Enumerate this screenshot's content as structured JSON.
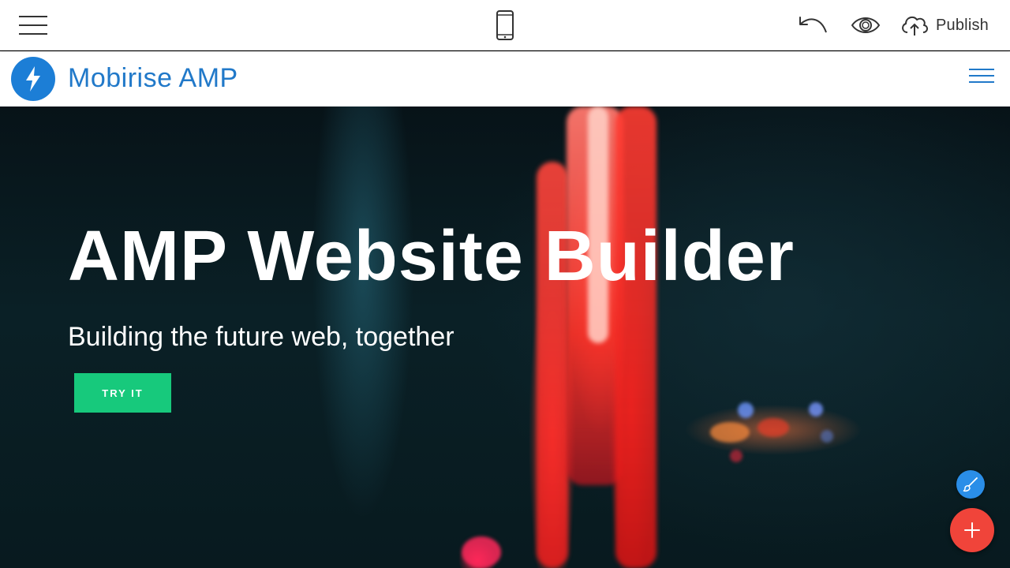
{
  "toolbar": {
    "menu_icon": "hamburger-menu-icon",
    "device_icon": "mobile-phone-icon",
    "undo_icon": "undo-icon",
    "preview_icon": "eye-icon",
    "publish_icon": "cloud-upload-icon",
    "publish_label": "Publish"
  },
  "site_nav": {
    "logo_icon": "lightning-bolt-icon",
    "brand_name": "Mobirise AMP",
    "menu_icon": "hamburger-menu-icon"
  },
  "hero": {
    "title": "AMP Website Builder",
    "subtitle": "Building the future web, together",
    "cta_label": "TRY IT"
  },
  "floating": {
    "edit_icon": "brush-icon",
    "add_icon": "plus-icon"
  },
  "colors": {
    "brand_blue": "#2179c9",
    "logo_blue": "#1c7ed6",
    "cta_green": "#17c97c",
    "fab_red": "#f0443a",
    "fab_blue": "#2a8ee8"
  }
}
